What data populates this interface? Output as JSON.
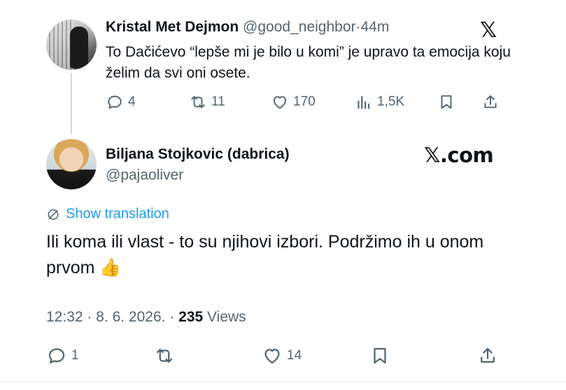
{
  "quoted_tweet": {
    "author_name": "Kristal Met Dejmon",
    "handle": "@good_neighbor",
    "separator": "·",
    "time_ago": "44m",
    "text": "To Dačićevo “lepše mi je bilo u komi” je upravo ta emocija koju želim da svi oni osete.",
    "actions": {
      "replies": "4",
      "reposts": "11",
      "likes": "170",
      "views": "1,5K"
    },
    "platform_icon": "x-logo-icon"
  },
  "main_tweet": {
    "author_name": "Biljana Stojkovic (dabrica)",
    "handle": "@pajaoliver",
    "brand": "𝕏.com",
    "show_translation": "Show translation",
    "text": "Ili koma ili vlast - to su njihovi izbori. Podržimo ih u onom prvom",
    "emoji": "👍",
    "time": "12:32",
    "date": "8. 6. 2026.",
    "views_count": "235",
    "views_label": "Views",
    "actions": {
      "replies": "1",
      "reposts": "",
      "likes": "14"
    }
  },
  "colors": {
    "text": "#0f1419",
    "muted": "#536471",
    "link": "#1d9bf0",
    "thread_line": "#cfd9de"
  }
}
